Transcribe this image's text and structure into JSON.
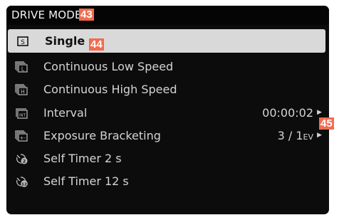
{
  "header": {
    "title": "DRIVE MODE"
  },
  "callouts": {
    "header": "43",
    "selected": "44",
    "arrows": "45"
  },
  "menu": {
    "items": [
      {
        "label": "Single",
        "icon": "single-shot-icon",
        "selected": true
      },
      {
        "label": "Continuous Low Speed",
        "icon": "continuous-low-icon"
      },
      {
        "label": "Continuous High Speed",
        "icon": "continuous-high-icon"
      },
      {
        "label": "Interval",
        "icon": "interval-icon",
        "value": "00:00:02"
      },
      {
        "label": "Exposure Bracketing",
        "icon": "exposure-bracketing-icon",
        "value": "3 / 1",
        "unit": "EV"
      },
      {
        "label": "Self Timer 2 s",
        "icon": "self-timer-2-icon"
      },
      {
        "label": "Self Timer 12 s",
        "icon": "self-timer-12-icon"
      }
    ]
  },
  "colors": {
    "background": "#0c0c0c",
    "selected_row": "#d9d9d9",
    "text": "#d4d4d4",
    "callout": "#f36b4f"
  }
}
